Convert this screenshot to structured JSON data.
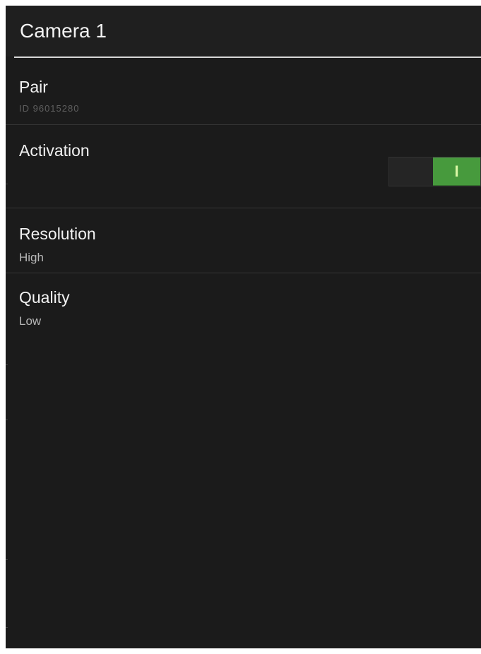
{
  "action_bar": {
    "title": "Camera 1"
  },
  "preferences": {
    "pair": {
      "title": "Pair",
      "summary": "ID 96015280"
    },
    "activation": {
      "title": "Activation",
      "toggle_state": "I"
    },
    "resolution": {
      "title": "Resolution",
      "summary": "High"
    },
    "quality": {
      "title": "Quality",
      "summary": "Low"
    }
  },
  "colors": {
    "background": "#1b1b1b",
    "toggle_on": "#479a3d",
    "toggle_label": "#d8f7a4",
    "divider": "#353535"
  }
}
